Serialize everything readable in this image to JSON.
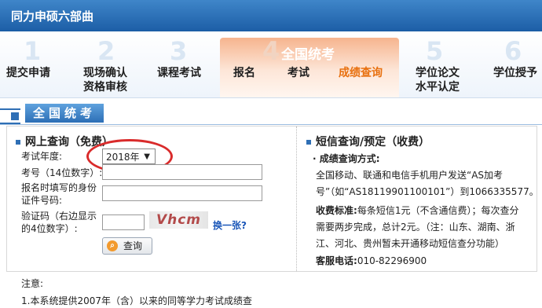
{
  "header": {
    "title": "同力申硕六部曲"
  },
  "steps": {
    "active_heading": "全国统考",
    "items": [
      {
        "num": "1",
        "label": "提交申请"
      },
      {
        "num": "2",
        "label": "现场确认",
        "label2": "资格审核"
      },
      {
        "num": "3",
        "label": "课程考试"
      },
      {
        "num": "4",
        "sub": [
          "报名",
          "考试",
          "成绩查询"
        ]
      },
      {
        "num": "5",
        "label": "学位论文",
        "label2": "水平认定"
      },
      {
        "num": "6",
        "label": "学位授予"
      }
    ]
  },
  "section": {
    "title": "全国统考"
  },
  "online": {
    "title": "网上查询（免费）",
    "year_label": "考试年度:",
    "year_value": "2018年",
    "exam_no_label": "考号（14位数字）:",
    "id_label_1": "报名时填写的身份",
    "id_label_2": "证件号码:",
    "captcha_label_1": "验证码（右边显示",
    "captcha_label_2": "的4位数字）:",
    "captcha_text": "Vhcm",
    "refresh_link": "换一张?",
    "query_button": "查询"
  },
  "sms": {
    "title": "短信查询/预定（收费）",
    "method_label": "· 成绩查询方式:",
    "line1": "全国移动、联通和电信手机用户发送“AS加考",
    "line2": "号”（如“AS18119901100101”）到1066335577。",
    "fee_label": "收费标准:",
    "fee_line1": "每条短信1元（不含通信费）；每次查分",
    "fee_line2": "需要两步完成，总计2元。（注：山东、湖南、浙",
    "fee_line3": "江、河北、贵州暂未开通移动短信查分功能）",
    "service_label": "客服电话:",
    "service_phone": "010-82296900"
  },
  "notes": {
    "heading": "注意:",
    "line1": "1.本系统提供2007年（含）以来的同等学力考试成绩查"
  },
  "colors": {
    "header_blue": "#1c5ea6",
    "active_orange": "#e8700f",
    "oval_red": "#d92b2b",
    "link_blue": "#1a56b8"
  }
}
